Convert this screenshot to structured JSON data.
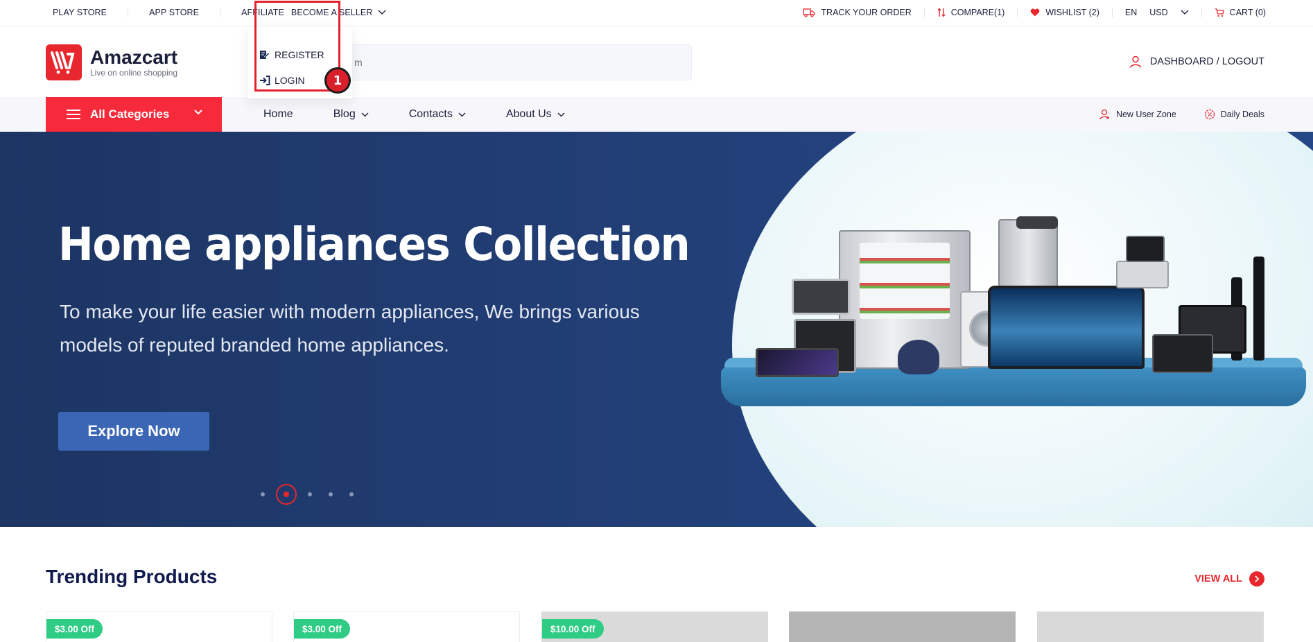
{
  "topbar": {
    "left_links": [
      "PLAY STORE",
      "APP STORE",
      "AFFILIATE",
      "BECOME A SELLER"
    ],
    "track_order": "TRACK YOUR ORDER",
    "compare": "COMPARE(1)",
    "wishlist": "WISHLIST (2)",
    "language": "EN",
    "currency": "USD",
    "cart": "CART (0)"
  },
  "seller_dropdown": {
    "items": [
      "REGISTER",
      "LOGIN"
    ],
    "marker": "1"
  },
  "header": {
    "logo_name": "Amazcart",
    "logo_tagline": "Live on online shopping",
    "search_placeholder": "m",
    "dashboard": "DASHBOARD / LOGOUT"
  },
  "nav": {
    "all_categories": "All Categories",
    "menu": [
      "Home",
      "Blog",
      "Contacts",
      "About Us"
    ],
    "new_user_zone": "New User Zone",
    "daily_deals": "Daily Deals"
  },
  "hero": {
    "title": "Home appliances Collection",
    "subtitle": "To make your life easier with modern appliances, We  brings various models of reputed branded home appliances.",
    "button": "Explore Now",
    "slides": 5,
    "active_slide": 2
  },
  "trending": {
    "title": "Trending Products",
    "view_all": "VIEW ALL",
    "badges": [
      "$3.00 Off",
      "$3.00 Off",
      "$10.00 Off"
    ]
  },
  "colors": {
    "brand_red": "#f62a3a",
    "hero_blue": "#223f77",
    "button_blue": "#3a66b5",
    "badge_green": "#2ecc84",
    "navy_text": "#101a4e"
  }
}
